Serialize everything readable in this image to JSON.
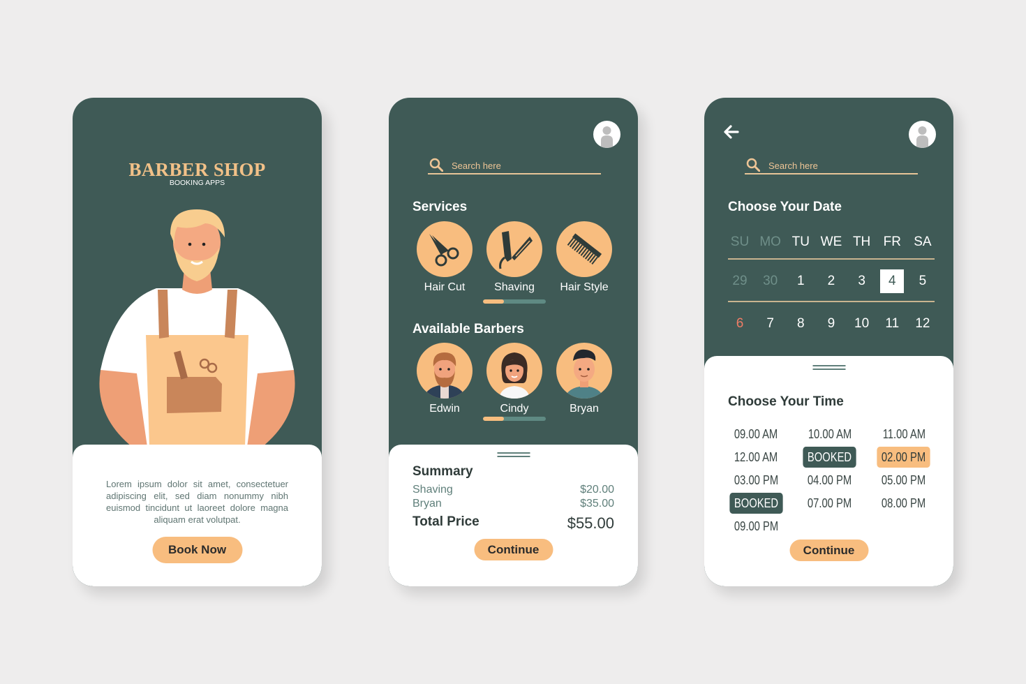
{
  "colors": {
    "background": "#eeeded",
    "primary_dark_green": "#3f5a56",
    "accent_peach": "#f8bd7f",
    "title_gold": "#f2c188",
    "sunday_red": "#f07d66",
    "text_dark": "#2f3b39"
  },
  "screen1": {
    "brand_title": "BARBER SHOP",
    "brand_subtitle": "BOOKING APPS",
    "description": "Lorem ipsum dolor sit amet, consectetuer adipiscing elit, sed diam nonummy nibh euismod tincidunt ut laoreet dolore magna aliquam erat volutpat.",
    "book_now_label": "Book Now"
  },
  "screen2": {
    "search_placeholder": "Search here",
    "services_title": "Services",
    "services": [
      {
        "label": "Hair Cut",
        "icon": "scissors-icon"
      },
      {
        "label": "Shaving",
        "icon": "razor-icon"
      },
      {
        "label": "Hair Style",
        "icon": "comb-icon"
      }
    ],
    "services_scroll_progress": 0.33,
    "barbers_title": "Available Barbers",
    "barbers": [
      {
        "name": "Edwin"
      },
      {
        "name": "Cindy"
      },
      {
        "name": "Bryan"
      }
    ],
    "barbers_scroll_progress": 0.33,
    "summary": {
      "title": "Summary",
      "items": [
        {
          "label": "Shaving",
          "price": "$20.00"
        },
        {
          "label": "Bryan",
          "price": "$35.00"
        }
      ],
      "total_label": "Total Price",
      "total_value": "$55.00"
    },
    "continue_label": "Continue"
  },
  "screen3": {
    "search_placeholder": "Search here",
    "date_title": "Choose Your Date",
    "weekdays": [
      "SU",
      "MO",
      "TU",
      "WE",
      "TH",
      "FR",
      "SA"
    ],
    "weekdays_muted": [
      true,
      true,
      false,
      false,
      false,
      false,
      false
    ],
    "week1": [
      {
        "day": "29",
        "state": "muted"
      },
      {
        "day": "30",
        "state": "muted"
      },
      {
        "day": "1",
        "state": "normal"
      },
      {
        "day": "2",
        "state": "normal"
      },
      {
        "day": "3",
        "state": "normal"
      },
      {
        "day": "4",
        "state": "selected"
      },
      {
        "day": "5",
        "state": "normal"
      }
    ],
    "week2": [
      {
        "day": "6",
        "state": "sunday"
      },
      {
        "day": "7",
        "state": "normal"
      },
      {
        "day": "8",
        "state": "normal"
      },
      {
        "day": "9",
        "state": "normal"
      },
      {
        "day": "10",
        "state": "normal"
      },
      {
        "day": "11",
        "state": "normal"
      },
      {
        "day": "12",
        "state": "normal"
      }
    ],
    "time_title": "Choose Your Time",
    "time_slots": [
      {
        "label": "09.00 AM",
        "state": "available"
      },
      {
        "label": "10.00 AM",
        "state": "available"
      },
      {
        "label": "11.00 AM",
        "state": "available"
      },
      {
        "label": "12.00 AM",
        "state": "available"
      },
      {
        "label": "BOOKED",
        "state": "booked"
      },
      {
        "label": "02.00 PM",
        "state": "selected"
      },
      {
        "label": "03.00 PM",
        "state": "available"
      },
      {
        "label": "04.00 PM",
        "state": "available"
      },
      {
        "label": "05.00 PM",
        "state": "available"
      },
      {
        "label": "BOOKED",
        "state": "booked"
      },
      {
        "label": "07.00 PM",
        "state": "available"
      },
      {
        "label": "08.00 PM",
        "state": "available"
      },
      {
        "label": "09.00 PM",
        "state": "available"
      }
    ],
    "continue_label": "Continue"
  }
}
